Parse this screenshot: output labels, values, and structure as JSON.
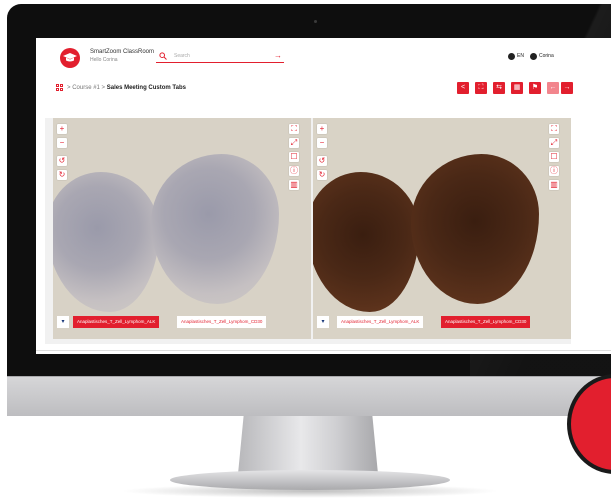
{
  "app": {
    "title": "SmartZoom ClassRoom",
    "greeting": "Hello Corina",
    "accent": "#e21f2e"
  },
  "search": {
    "placeholder": "Search",
    "icon": "search-icon",
    "submit_icon": "arrow-right-icon"
  },
  "header_right": {
    "language": "EN",
    "user": "Corina"
  },
  "breadcrumb": {
    "home_icon": "grid-icon",
    "separator": ">",
    "course": "Course #1",
    "page": "Sales Meeting Custom Tabs"
  },
  "toolbar": {
    "share_icon": "share-icon",
    "fit_icon": "fit-icon",
    "sync_icon": "sync-icon",
    "layout_icon": "layout-grid-icon",
    "flag_icon": "flag-icon",
    "back_icon": "arrow-left-icon",
    "forward_icon": "arrow-right-icon",
    "labels": {
      "share": "<",
      "fit": "⛶",
      "sync": "⇆",
      "layout": "▦",
      "flag": "⚑",
      "back": "←",
      "forward": "→"
    }
  },
  "viewer_controls": {
    "zoom_in": "+",
    "zoom_out": "−",
    "rotate_left": "↺",
    "rotate_right": "↻",
    "fit": "⛶",
    "expand": "⤢",
    "annotate": "☐",
    "info": "ⓘ",
    "map": "▥",
    "tab_toggle": "▾"
  },
  "viewers": [
    {
      "stain": "light",
      "tabs": [
        {
          "label": "Anaplastisches_T_Zell_Lymphom_ALK",
          "active": true
        },
        {
          "label": "Anaplastisches_T_Zell_Lymphom_CD30",
          "active": false
        }
      ]
    },
    {
      "stain": "dark",
      "tabs": [
        {
          "label": "Anaplastisches_T_Zell_Lymphom_ALK",
          "active": false
        },
        {
          "label": "Anaplastisches_T_Zell_Lymphom_CD30",
          "active": true
        }
      ]
    }
  ]
}
